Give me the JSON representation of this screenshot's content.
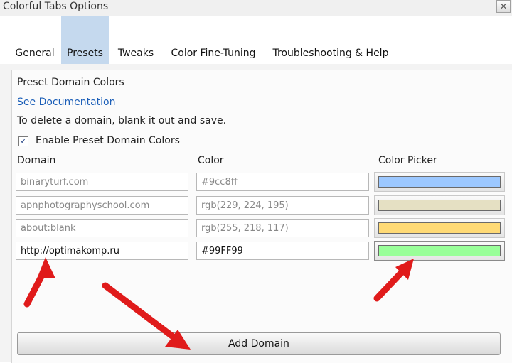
{
  "window": {
    "title": "Colorful Tabs Options",
    "close_glyph": "✕"
  },
  "tabs": [
    {
      "label": "General",
      "active": false
    },
    {
      "label": "Presets",
      "active": true
    },
    {
      "label": "Tweaks",
      "active": false
    },
    {
      "label": "Color Fine-Tuning",
      "active": false
    },
    {
      "label": "Troubleshooting & Help",
      "active": false
    }
  ],
  "presets": {
    "heading": "Preset Domain Colors",
    "doc_link": "See Documentation",
    "instruction": "To delete a domain, blank it out and save.",
    "enable_label": "Enable Preset Domain Colors",
    "enable_checked": true,
    "check_glyph": "✓",
    "columns": {
      "domain": "Domain",
      "color": "Color",
      "picker": "Color Picker"
    },
    "rows": [
      {
        "domain": "binaryturf.com",
        "color": "#9cc8ff",
        "swatch": "#9cc8ff"
      },
      {
        "domain": "apnphotographyschool.com",
        "color": "rgb(229, 224, 195)",
        "swatch": "#e5e0c3"
      },
      {
        "domain": "about:blank",
        "color": "rgb(255, 218, 117)",
        "swatch": "#ffda75"
      },
      {
        "domain": "http://optimakomp.ru",
        "color": "#99FF99",
        "swatch": "#99ff99"
      }
    ],
    "add_button": "Add Domain"
  },
  "colors": {
    "arrow": "#e01b1b",
    "active_tab": "#c5d9ee",
    "link": "#1c5fb8"
  }
}
